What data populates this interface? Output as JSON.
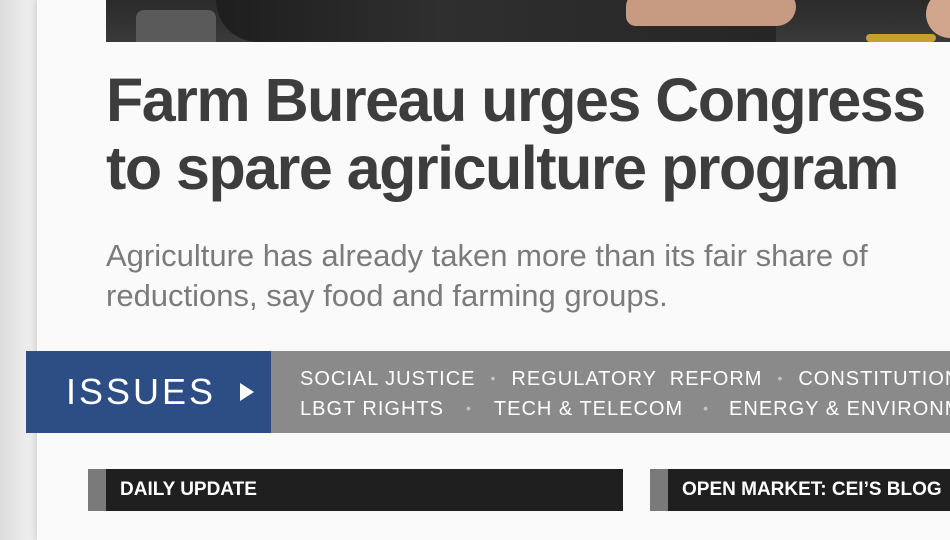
{
  "article": {
    "headline_line1": "Farm Bureau urges Congress",
    "headline_line2": "to spare agriculture program",
    "subhead_line1": "Agriculture has already taken more than its fair share of",
    "subhead_line2": "reductions, say food and farming groups."
  },
  "issues": {
    "label": "ISSUES",
    "row1": [
      "SOCIAL JUSTICE",
      "REGULATORY  REFORM",
      "CONSTITUTION"
    ],
    "row2": [
      "LBGT RIGHTS",
      "TECH & TELECOM",
      "ENERGY & ENVIRONMENT"
    ],
    "separator": "•"
  },
  "sections": {
    "daily_update": "DAILY UPDATE",
    "open_market": "OPEN MARKET: CEI’S BLOG"
  },
  "colors": {
    "issues_label_bg": "#2d4d85",
    "issues_bar_bg": "#8a8a8a",
    "section_bar_bg": "#1f1f1f",
    "headline": "#3d3d3d",
    "subhead": "#7b7b7b"
  }
}
